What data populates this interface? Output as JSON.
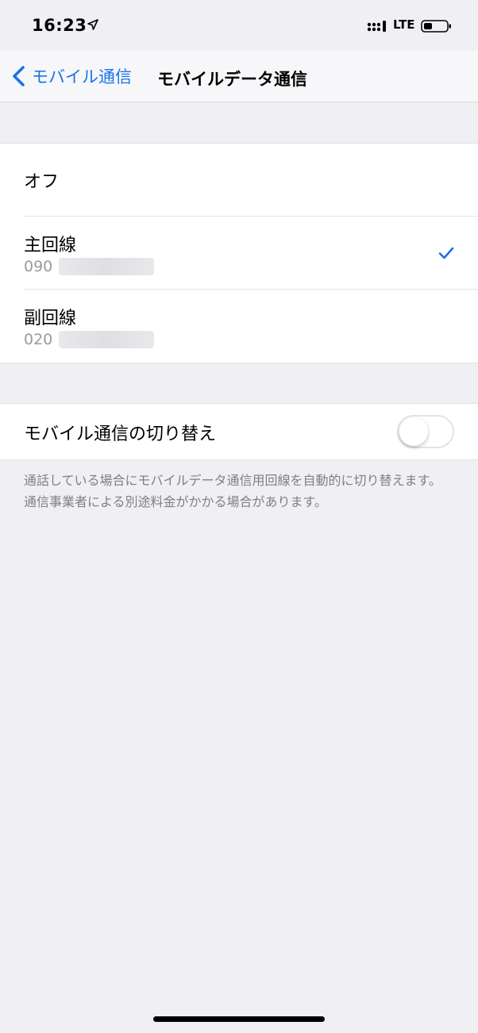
{
  "status_bar": {
    "time": "16:23",
    "network": "LTE"
  },
  "nav": {
    "back_label": "モバイル通信",
    "title": "モバイルデータ通信"
  },
  "options": [
    {
      "title": "オフ"
    },
    {
      "title": "主回線",
      "number_prefix": "090",
      "selected": true
    },
    {
      "title": "副回線",
      "number_prefix": "020",
      "selected": false
    }
  ],
  "switching": {
    "label": "モバイル通信の切り替え",
    "enabled": false,
    "note": "通話している場合にモバイルデータ通信用回線を自動的に切り替えます。通信事業者による別途料金がかかる場合があります。"
  },
  "colors": {
    "accent": "#1a73e8",
    "background": "#efeff4"
  }
}
